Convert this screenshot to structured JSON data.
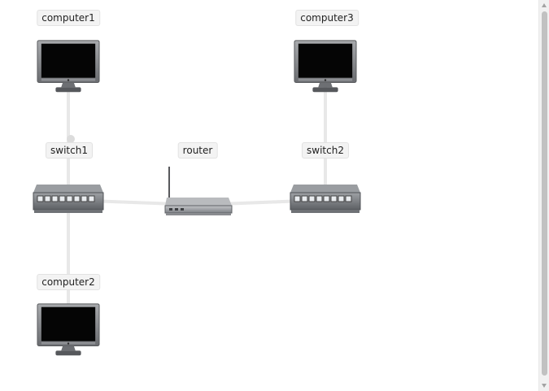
{
  "nodes": {
    "computer1": {
      "label": "computer1",
      "icon": "monitor-icon"
    },
    "computer2": {
      "label": "computer2",
      "icon": "monitor-icon"
    },
    "computer3": {
      "label": "computer3",
      "icon": "monitor-icon"
    },
    "switch1": {
      "label": "switch1",
      "icon": "network-switch-icon"
    },
    "switch2": {
      "label": "switch2",
      "icon": "network-switch-icon"
    },
    "router": {
      "label": "router",
      "icon": "wireless-router-icon"
    }
  },
  "links": [
    {
      "from": "computer1",
      "to": "switch1"
    },
    {
      "from": "switch1",
      "to": "computer2"
    },
    {
      "from": "switch1",
      "to": "router"
    },
    {
      "from": "router",
      "to": "switch2"
    },
    {
      "from": "switch2",
      "to": "computer3"
    }
  ],
  "colors": {
    "link": "#e8e8e8",
    "label_bg": "#f3f3f3",
    "device_body": "#7b7d80",
    "screen": "#050505"
  }
}
